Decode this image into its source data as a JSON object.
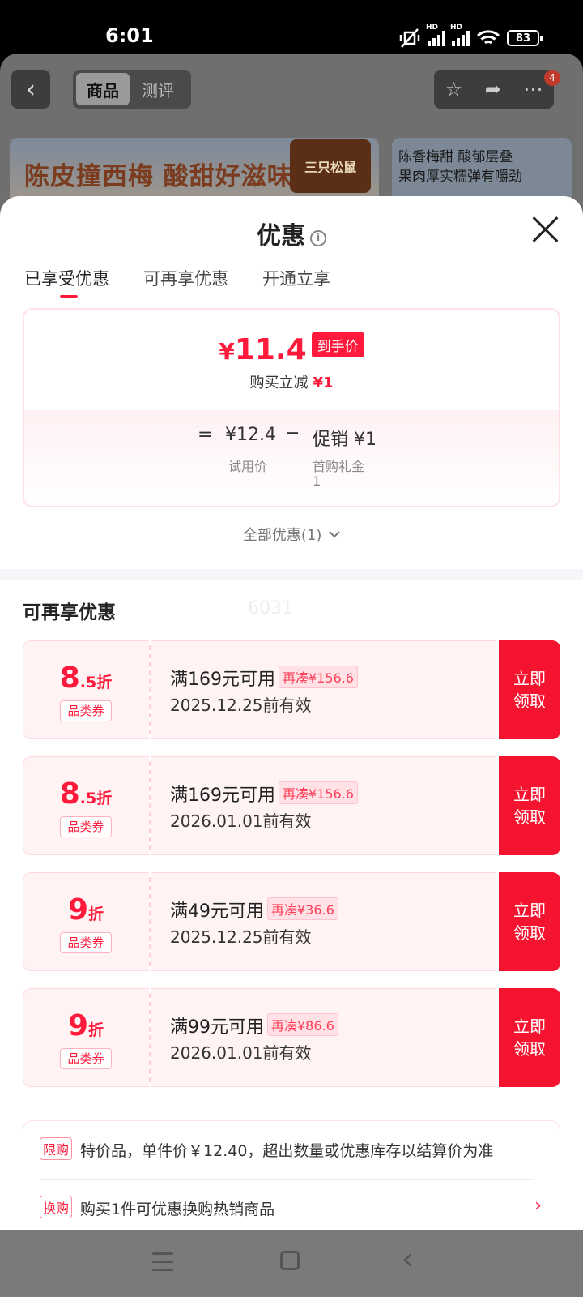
{
  "status": {
    "time": "6:01",
    "battery": "83",
    "hd1": "HD",
    "hd2": "HD"
  },
  "background": {
    "tab_active": "商品",
    "tab_inactive": "测评",
    "badge": "4",
    "banner_text": "陈皮撞西梅 酸甜好滋味",
    "banner_logo": "三只松鼠",
    "banner2_line1": "陈香梅甜 酸郁层叠",
    "banner2_line2": "果肉厚实糯弹有嚼劲"
  },
  "sheet": {
    "title": "优惠",
    "tabs": [
      "已享受优惠",
      "可再享优惠",
      "开通立享"
    ],
    "summary": {
      "currency": "¥",
      "final_price": "11.4",
      "final_tag": "到手价",
      "cut_label": "购买立减",
      "cut_amount": "¥1",
      "eq": "=",
      "base_price": "¥12.4",
      "minus": "−",
      "promo": "促销 ¥1",
      "base_label": "试用价",
      "promo_label_1": "首购礼金",
      "promo_label_2": "1"
    },
    "all_offers": "全部优惠(1)",
    "section_title": "可再享优惠",
    "watermark": "6031",
    "coupons": [
      {
        "big": "8",
        "small": ".5折",
        "type": "品类券",
        "cond": "满169元可用",
        "tag": "再凑¥156.6",
        "date": "2025.12.25前有效",
        "btn1": "立即",
        "btn2": "领取"
      },
      {
        "big": "8",
        "small": ".5折",
        "type": "品类券",
        "cond": "满169元可用",
        "tag": "再凑¥156.6",
        "date": "2026.01.01前有效",
        "btn1": "立即",
        "btn2": "领取"
      },
      {
        "big": "9",
        "small": "折",
        "type": "品类券",
        "cond": "满49元可用",
        "tag": "再凑¥36.6",
        "date": "2025.12.25前有效",
        "btn1": "立即",
        "btn2": "领取"
      },
      {
        "big": "9",
        "small": "折",
        "type": "品类券",
        "cond": "满99元可用",
        "tag": "再凑¥86.6",
        "date": "2026.01.01前有效",
        "btn1": "立即",
        "btn2": "领取"
      }
    ],
    "notes": [
      {
        "tag": "限购",
        "text": "特价品，单件价￥12.40，超出数量或优惠库存以结算价为准"
      },
      {
        "tag": "换购",
        "text": "购买1件可优惠换购热销商品"
      }
    ]
  },
  "colors": {
    "accent": "#ff1a3b",
    "button": "#f5142f"
  }
}
